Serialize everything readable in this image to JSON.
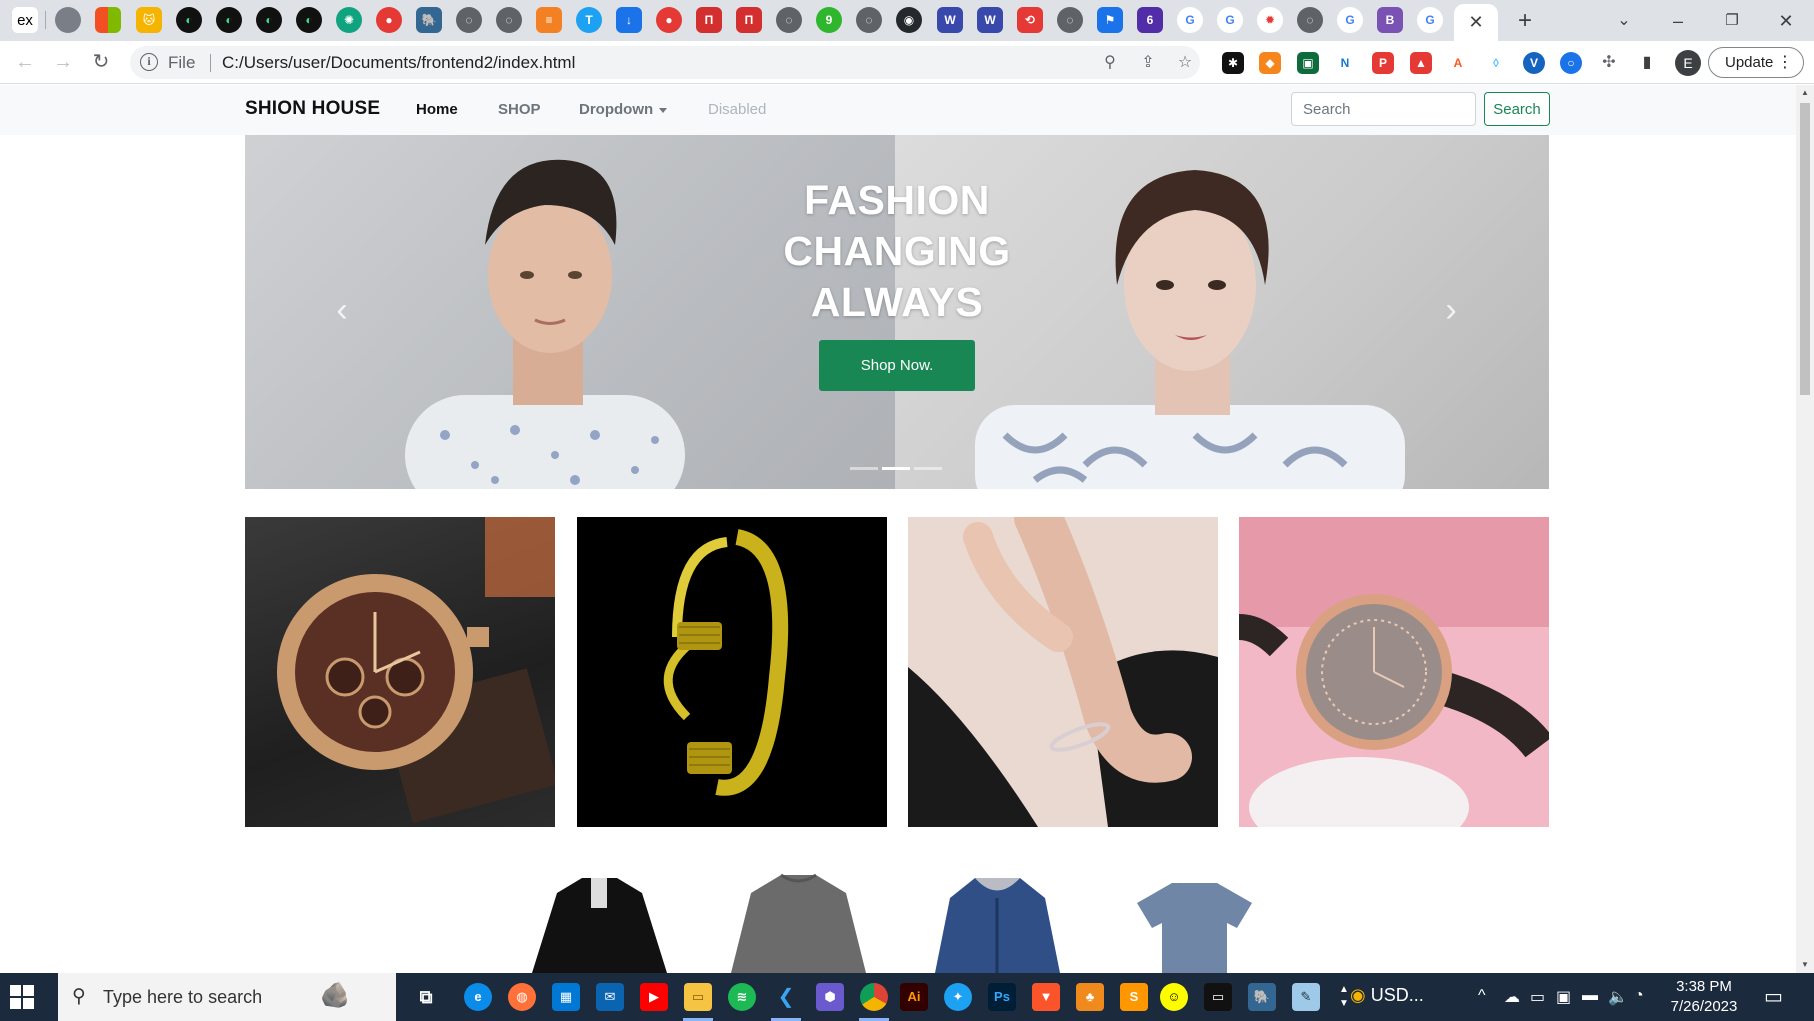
{
  "browser": {
    "address": {
      "scheme_label": "File",
      "url": "C:/Users/user/Documents/frontend2/index.html"
    },
    "profile_initial": "E",
    "update_label": "Update"
  },
  "site": {
    "brand": "SHION HOUSE",
    "nav": {
      "home": "Home",
      "shop": "SHOP",
      "dropdown": "Dropdown",
      "disabled": "Disabled"
    },
    "search": {
      "placeholder": "Search",
      "button_label": "Search"
    },
    "carousel": {
      "caption_lines": [
        "FASHION",
        "CHANGING",
        "ALWAYS"
      ],
      "cta_label": "Shop Now.",
      "active_slide_index": 1,
      "slide_count": 3
    },
    "products": [
      {
        "name": "gold-chronograph-watch-image"
      },
      {
        "name": "gold-bangle-bracelet-image"
      },
      {
        "name": "woman-wearing-bracelet-image"
      },
      {
        "name": "rose-gold-ladies-watch-image"
      }
    ],
    "clothing_row": [
      {
        "name": "black-polo-shirt-image"
      },
      {
        "name": "grey-sweater-image"
      },
      {
        "name": "denim-hooded-jacket-image"
      },
      {
        "name": "blue-tshirt-image"
      }
    ]
  },
  "taskbar": {
    "search_placeholder": "Type here to search",
    "weather_label": "USD...",
    "time": "3:38 PM",
    "date": "7/26/2023"
  },
  "colors": {
    "accent_green": "#198754",
    "navbar_bg": "#f8f9fa",
    "taskbar_bg": "#1b2a3d",
    "tabstrip_bg": "#dee1e6"
  }
}
